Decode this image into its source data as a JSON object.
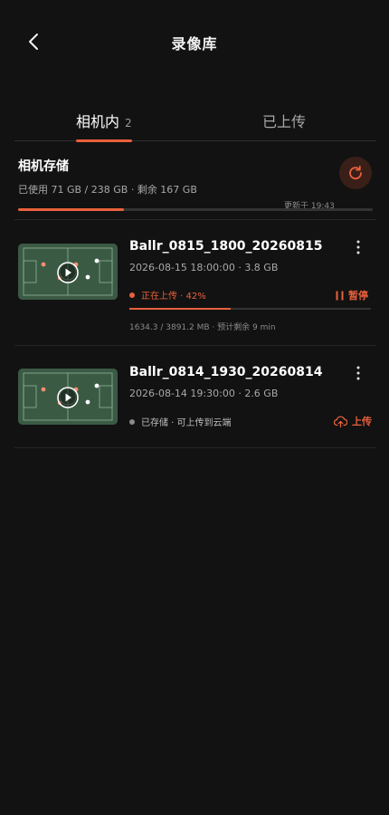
{
  "header": {
    "title": "录像库",
    "back_icon": "chevron-left-icon"
  },
  "tabs": [
    {
      "label": "相机内",
      "count": "2",
      "active": true
    },
    {
      "label": "已上传",
      "active": false
    }
  ],
  "storage": {
    "title": "相机存储",
    "usage": "已使用 71 GB / 238 GB · 剩余 167 GB",
    "used_fraction": 0.298,
    "updated": "更新于 19:43",
    "refresh_icon": "refresh-icon"
  },
  "videos": [
    {
      "name": "Ballr_0815_1800_20260815",
      "meta": "2026-08-15 18:00:00 · 3.8 GB",
      "status": "正在上传 · 42%",
      "status_color": "#e8603c",
      "action": "暂停",
      "action_icon": "pause-icon",
      "progress": 0.42,
      "detail": "1634.3 / 3891.2 MB · 预计剩余 9 min"
    },
    {
      "name": "Ballr_0814_1930_20260814",
      "meta": "2026-08-14 19:30:00 · 2.6 GB",
      "status": "已存储 · 可上传到云端",
      "status_color": "#8a8a8a",
      "action": "上传",
      "action_icon": "cloud-upload-icon"
    }
  ],
  "colors": {
    "accent": "#e8603c",
    "background": "#121212"
  }
}
